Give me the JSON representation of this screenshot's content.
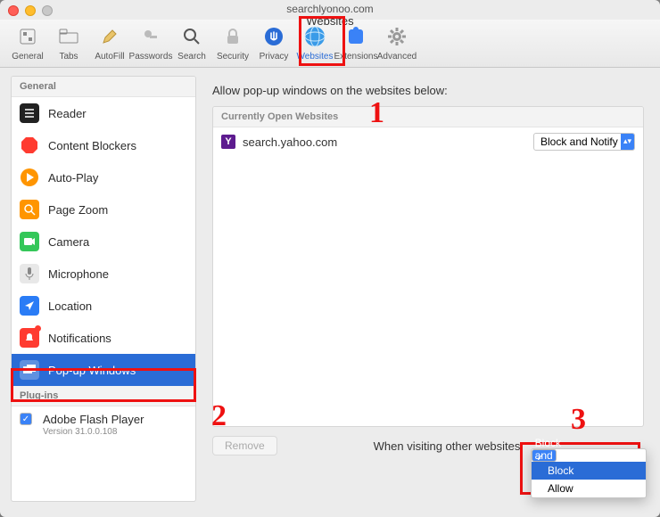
{
  "window": {
    "url_fragment": "searchlyonoo.com",
    "title": "Websites"
  },
  "toolbar": [
    {
      "id": "general",
      "label": "General"
    },
    {
      "id": "tabs",
      "label": "Tabs"
    },
    {
      "id": "autofill",
      "label": "AutoFill"
    },
    {
      "id": "passwords",
      "label": "Passwords"
    },
    {
      "id": "search",
      "label": "Search"
    },
    {
      "id": "security",
      "label": "Security"
    },
    {
      "id": "privacy",
      "label": "Privacy"
    },
    {
      "id": "websites",
      "label": "Websites",
      "selected": true
    },
    {
      "id": "extensions",
      "label": "Extensions"
    },
    {
      "id": "advanced",
      "label": "Advanced"
    }
  ],
  "sidebar": {
    "group1": "General",
    "items": [
      {
        "id": "reader",
        "label": "Reader"
      },
      {
        "id": "content-blockers",
        "label": "Content Blockers"
      },
      {
        "id": "auto-play",
        "label": "Auto-Play"
      },
      {
        "id": "page-zoom",
        "label": "Page Zoom"
      },
      {
        "id": "camera",
        "label": "Camera"
      },
      {
        "id": "microphone",
        "label": "Microphone"
      },
      {
        "id": "location",
        "label": "Location"
      },
      {
        "id": "notifications",
        "label": "Notifications",
        "badge": true
      },
      {
        "id": "popup",
        "label": "Pop-up Windows",
        "selected": true
      }
    ],
    "group2": "Plug-ins",
    "plugin": {
      "label": "Adobe Flash Player",
      "version": "Version 31.0.0.108",
      "checked": true
    }
  },
  "main": {
    "heading": "Allow pop-up windows on the websites below:",
    "list_header": "Currently Open Websites",
    "rows": [
      {
        "favicon": "Y",
        "domain": "search.yahoo.com",
        "setting": "Block and Notify"
      }
    ],
    "remove_label": "Remove",
    "other_label": "When visiting other websites:",
    "dropdown": {
      "options": [
        "Block and Notify",
        "Block",
        "Allow"
      ],
      "checked": "Block and Notify",
      "highlighted": "Block"
    }
  },
  "annotations": {
    "a1": "1",
    "a2": "2",
    "a3": "3"
  }
}
